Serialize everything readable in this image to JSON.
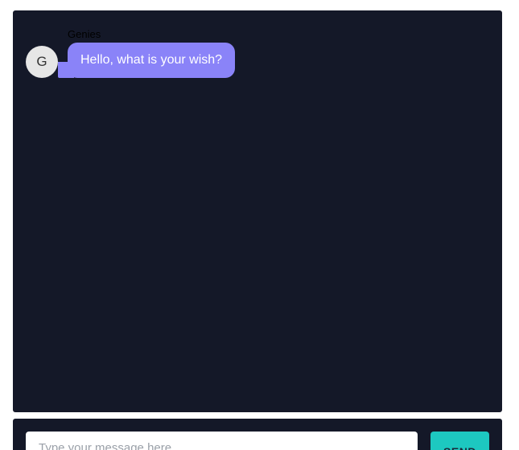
{
  "chat": {
    "messages": [
      {
        "sender": "Genies",
        "avatar_initial": "G",
        "text": "Hello, what is your wish?"
      }
    ]
  },
  "composer": {
    "placeholder": "Type your message here",
    "send_label": "SEND"
  },
  "colors": {
    "window_background": "#141828",
    "bubble": "#8a83f8",
    "send_button": "#1dc8c0"
  }
}
